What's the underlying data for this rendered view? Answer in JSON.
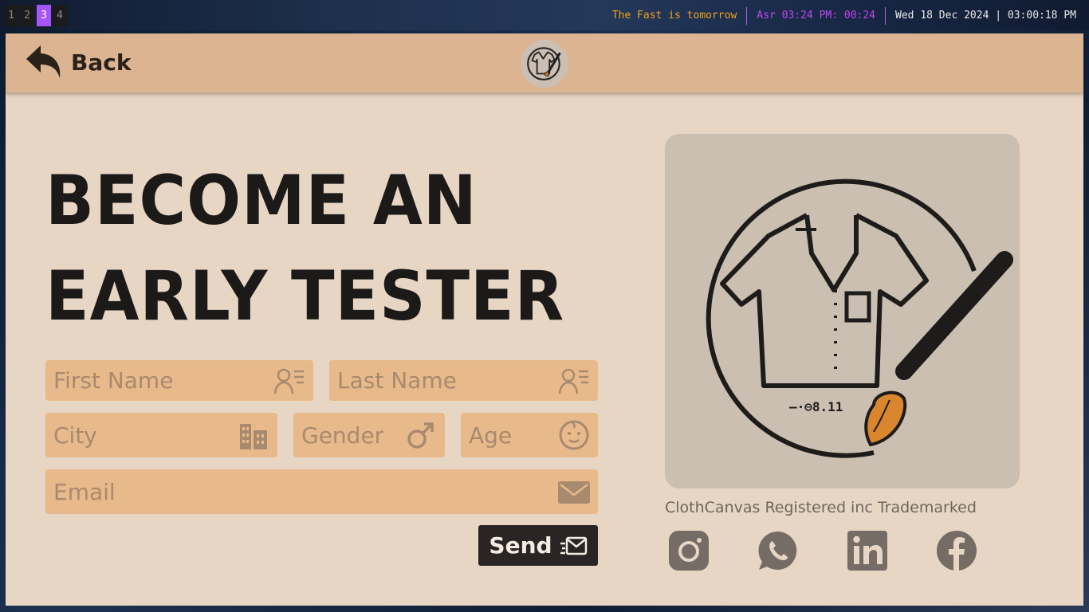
{
  "topbar": {
    "workspaces": [
      "1",
      "2",
      "3",
      "4"
    ],
    "active_workspace": "3",
    "fast_notice": "The Fast is tomorrow",
    "prayer": "Asr 03:24 PM: 00:24",
    "datetime": "Wed 18 Dec 2024 | 03:00:18 PM"
  },
  "header": {
    "back_label": "Back",
    "back_icon": "reply-arrow-icon",
    "logo_icon": "shirt-brush-logo-icon"
  },
  "hero": {
    "line1": "BECOME AN",
    "line2": "EARLY TESTER"
  },
  "form": {
    "first_name": {
      "placeholder": "First Name",
      "icon": "user-card-icon"
    },
    "last_name": {
      "placeholder": "Last Name",
      "icon": "user-card-icon"
    },
    "city": {
      "placeholder": "City",
      "icon": "buildings-icon"
    },
    "gender": {
      "placeholder": "Gender",
      "icon": "male-symbol-icon"
    },
    "age": {
      "placeholder": "Age",
      "icon": "baby-face-icon"
    },
    "email": {
      "placeholder": "Email",
      "icon": "envelope-icon"
    },
    "send_label": "Send",
    "send_icon": "send-mail-icon"
  },
  "brand": {
    "logo_icon": "shirt-brush-logo-icon",
    "logo_text": "—·⊖8.11",
    "caption": "ClothCanvas Registered inc Trademarked",
    "socials": [
      "instagram-icon",
      "whatsapp-icon",
      "linkedin-icon",
      "facebook-icon"
    ]
  },
  "colors": {
    "page_bg": "#e7d6c4",
    "header_bg": "#dcb491",
    "field_bg": "#e8b98b",
    "placeholder": "#a88a6e",
    "text_dark": "#1c1a19",
    "button_bg": "#2a2524",
    "workspace_active": "#a855f7",
    "fast_color": "#f0a21c",
    "prayer_color": "#c244f0"
  }
}
